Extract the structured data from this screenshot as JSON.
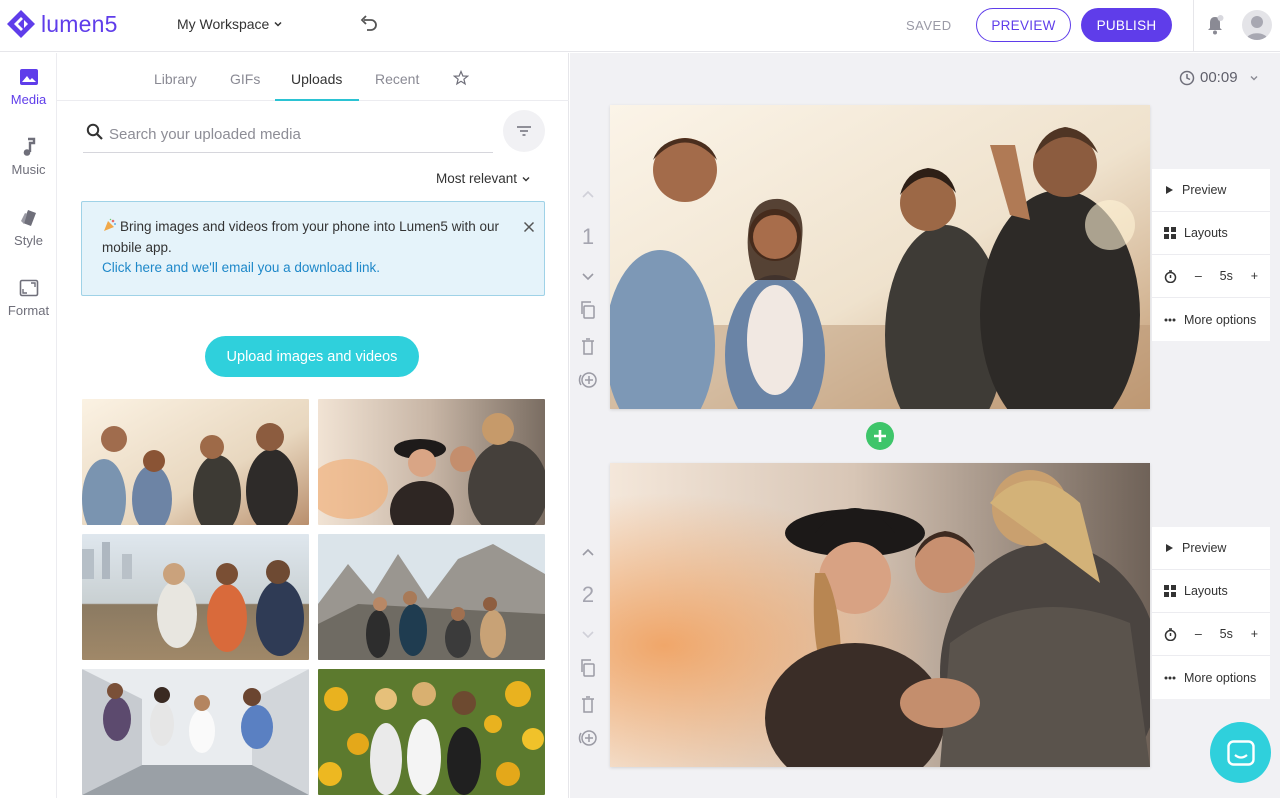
{
  "app": {
    "logo_text": "lumen5",
    "workspace": "My Workspace",
    "saved_status": "SAVED",
    "preview_label": "PREVIEW",
    "publish_label": "PUBLISH",
    "brand_color": "#5f3dea",
    "accent_color": "#2fd0dc"
  },
  "rail": {
    "items": [
      {
        "label": "Media",
        "icon": "image-icon",
        "active": true
      },
      {
        "label": "Music",
        "icon": "music-note-icon",
        "active": false
      },
      {
        "label": "Style",
        "icon": "palette-icon",
        "active": false
      },
      {
        "label": "Format",
        "icon": "aspect-ratio-icon",
        "active": false
      }
    ]
  },
  "panel": {
    "tabs": [
      {
        "label": "Library"
      },
      {
        "label": "GIFs"
      },
      {
        "label": "Uploads",
        "active": true
      },
      {
        "label": "Recent"
      }
    ],
    "search_placeholder": "Search your uploaded media",
    "sort_label": "Most relevant",
    "notice": {
      "text": "Bring images and videos from your phone into Lumen5 with our mobile app.",
      "link": "Click here and we'll email you a download link."
    },
    "upload_label": "Upload images and videos",
    "thumbnails": [
      {
        "name": "friends-laughing-sunset"
      },
      {
        "name": "women-hat-bokeh"
      },
      {
        "name": "friends-dancing-pier"
      },
      {
        "name": "hikers-mountain"
      },
      {
        "name": "friends-jumping-hallway"
      },
      {
        "name": "girls-sunflower-field"
      }
    ]
  },
  "editor": {
    "duration": "00:09",
    "scenes": [
      {
        "number": "1",
        "duration": "5s"
      },
      {
        "number": "2",
        "duration": "5s"
      }
    ],
    "side_menu": {
      "preview": "Preview",
      "layouts": "Layouts",
      "minus": "–",
      "plus": "+",
      "more": "More options"
    }
  }
}
